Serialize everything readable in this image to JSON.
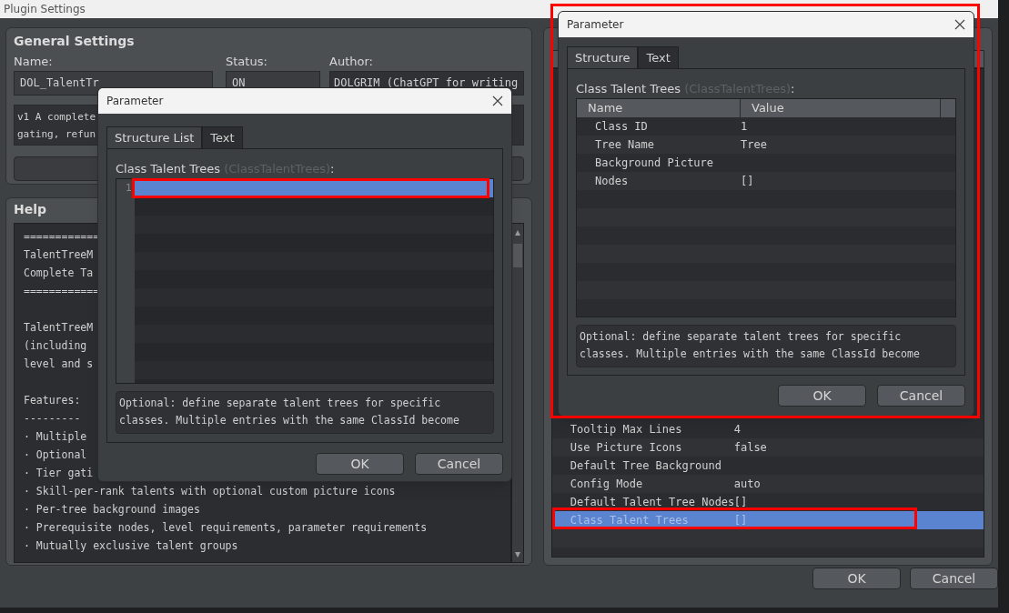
{
  "window": {
    "title": "Plugin Settings"
  },
  "general": {
    "title": "General Settings",
    "name_label": "Name:",
    "name_value": "DOL_TalentTr",
    "status_label": "Status:",
    "status_value": "ON",
    "author_label": "Author:",
    "author_value": "DOLGRIM (ChatGPT for writing",
    "description": [
      "v1 A complete",
      "gating, refun"
    ]
  },
  "help": {
    "title": "Help",
    "blocks": [
      [
        "============",
        "TalentTreeM",
        "Complete Ta",
        "============"
      ],
      [
        "TalentTreeM",
        "(including ",
        "level and s"
      ],
      [
        "Features:",
        "---------",
        "· Multiple ",
        "· Optional ",
        "· Tier gati",
        "· Skill-per-rank talents with optional custom picture icons",
        "· Per-tree background images",
        "· Prerequisite nodes, level requirements, parameter requirements",
        "· Mutually exclusive talent groups"
      ]
    ]
  },
  "parameters": {
    "rows": [
      {
        "name": "Tooltip Max Lines",
        "value": "4",
        "selected": false
      },
      {
        "name": "Use Picture Icons",
        "value": "false",
        "selected": false
      },
      {
        "name": "Default Tree Background",
        "selected": false
      },
      {
        "name": "Config Mode",
        "value": "auto",
        "selected": false
      },
      {
        "name": "Default Talent Tree Nodes",
        "value": "[]",
        "selected": false
      },
      {
        "name": "Class Talent Trees",
        "value": "[]",
        "selected": true
      }
    ]
  },
  "buttons": [
    "OK",
    "Cancel"
  ],
  "list_dialog": {
    "title": "Parameter",
    "tabs": [
      {
        "label": "Structure List",
        "selected": true
      },
      {
        "label": "Text",
        "selected": false
      }
    ],
    "label": "Class Talent Trees",
    "code": "(ClassTalentTrees)",
    "colon": ":",
    "items": [
      {
        "number": "1",
        "selected": true
      }
    ],
    "description": "Optional: define separate talent trees for specific classes. Multiple entries with the same ClassId become",
    "buttons": [
      "OK",
      "Cancel"
    ]
  },
  "struct_dialog": {
    "title": "Parameter",
    "tabs": [
      {
        "label": "Structure",
        "selected": true
      },
      {
        "label": "Text",
        "selected": false
      }
    ],
    "label": "Class Talent Trees",
    "code": "(ClassTalentTrees)",
    "colon": ":",
    "columns": [
      "Name",
      "Value"
    ],
    "rows": [
      {
        "name": "Class ID",
        "value": "1"
      },
      {
        "name": "Tree Name",
        "value": "Tree"
      },
      {
        "name": "Background Picture"
      },
      {
        "name": "Nodes",
        "value": "[]"
      }
    ],
    "description": "Optional: define separate talent trees for specific classes. Multiple entries with the same ClassId become",
    "buttons": [
      "OK",
      "Cancel"
    ]
  }
}
